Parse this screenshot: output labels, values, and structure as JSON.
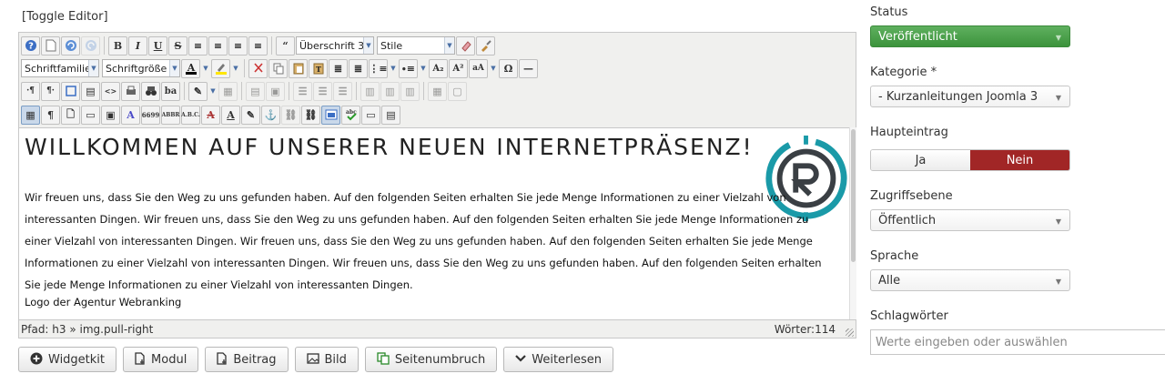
{
  "editor": {
    "toggle_label": "[Toggle Editor]",
    "format_select": "Überschrift 3",
    "style_select": "Stile",
    "font_family_select": "Schriftfamilie",
    "font_size_select": "Schriftgröße",
    "heading": "WILLKOMMEN AUF UNSERER NEUEN INTERNETPRÄSENZ!",
    "paragraph": "Wir freuen uns, dass Sie den Weg zu uns gefunden haben. Auf den folgenden Seiten erhalten Sie jede Menge Informationen zu einer Vielzahl von interessanten Dingen. Wir freuen uns, dass Sie den Weg zu uns gefunden haben. Auf den folgenden Seiten erhalten Sie jede Menge Informationen zu einer Vielzahl von interessanten Dingen. Wir freuen uns, dass Sie den Weg zu uns gefunden haben. Auf den folgenden Seiten erhalten Sie jede Menge Informationen zu einer Vielzahl von interessanten Dingen. Wir freuen uns, dass Sie den Weg zu uns gefunden haben. Auf den folgenden Seiten erhalten Sie jede Menge Informationen zu einer Vielzahl von interessanten Dingen.",
    "caption": "Logo der Agentur Webranking",
    "path": "Pfad:  h3 » img.pull-right",
    "word_count": "Wörter:114",
    "buttons": {
      "widgetkit": "Widgetkit",
      "modul": "Modul",
      "beitrag": "Beitrag",
      "bild": "Bild",
      "seitenumbruch": "Seitenumbruch",
      "weiterlesen": "Weiterlesen"
    }
  },
  "sidebar": {
    "status_label": "Status",
    "status_value": "Veröffentlicht",
    "category_label": "Kategorie *",
    "category_value": "- Kurzanleitungen Joomla 3",
    "featured_label": "Haupteintrag",
    "featured_yes": "Ja",
    "featured_no": "Nein",
    "access_label": "Zugriffsebene",
    "access_value": "Öffentlich",
    "language_label": "Sprache",
    "language_value": "Alle",
    "tags_label": "Schlagwörter",
    "tags_placeholder": "Werte eingeben oder auswählen"
  },
  "colors": {
    "status_green": "#46a046",
    "featured_no_red": "#a12626",
    "logo_teal": "#1a9aa8",
    "logo_dark": "#3a3f44"
  },
  "icons": [
    "help-icon",
    "new-document-icon",
    "undo-icon",
    "redo-icon",
    "bold-icon",
    "italic-icon",
    "underline-icon",
    "strikethrough-icon",
    "align-icons",
    "blockquote-icon",
    "eraser-icon",
    "brush-icon",
    "cut-icon",
    "copy-icon",
    "paste-icon",
    "list-icon",
    "omega-icon",
    "print-icon",
    "find-icon",
    "table-icon",
    "image-icon",
    "spellcheck-icon"
  ]
}
